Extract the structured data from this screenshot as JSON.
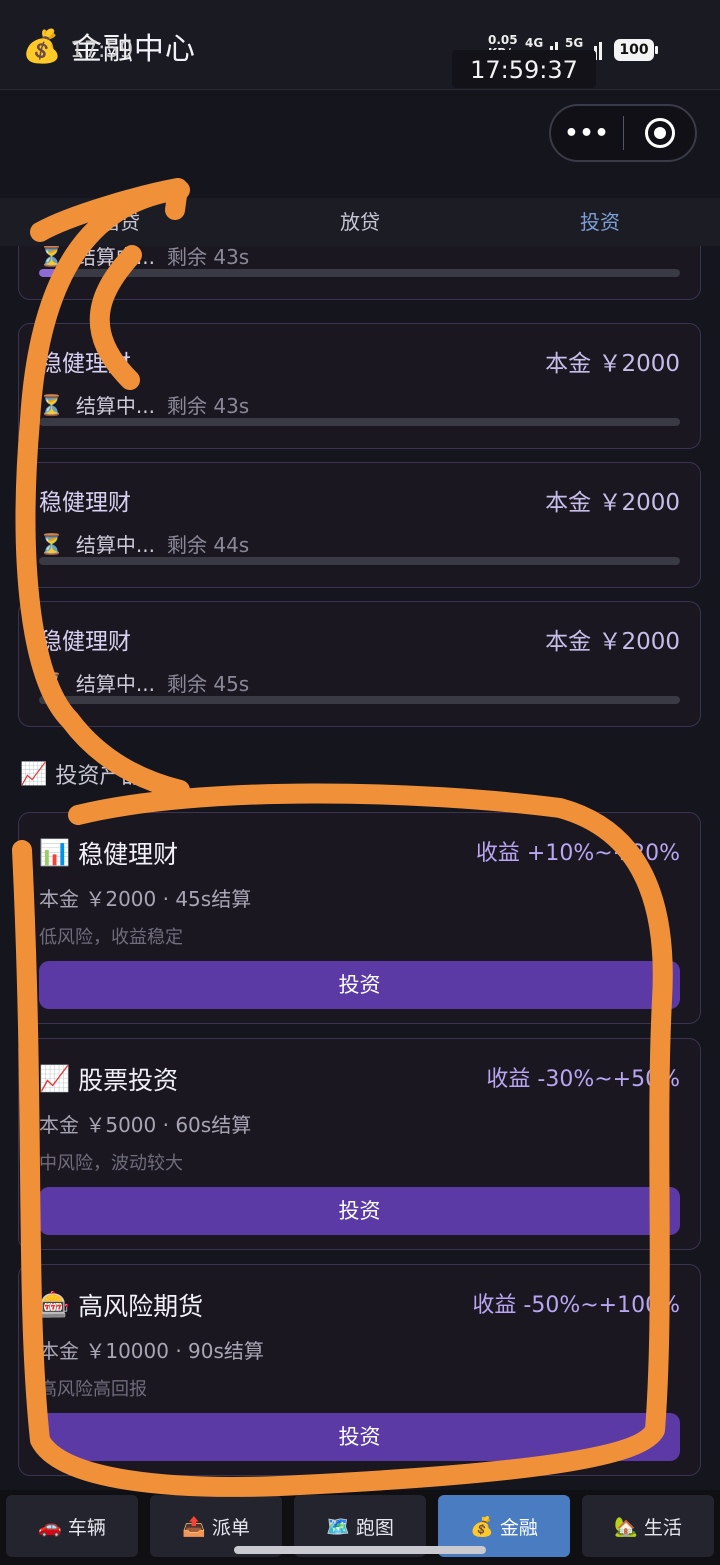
{
  "status_bar": {
    "time_small": "17:59",
    "network_speed": "0.05 KB/s",
    "network_type": "4G",
    "network_type2": "5G",
    "battery": "100",
    "clock": "17:59:37"
  },
  "header": {
    "icon": "💰",
    "title": "金融中心",
    "capsule_more": "•••"
  },
  "tabs": [
    {
      "label": "借贷",
      "active": false
    },
    {
      "label": "放贷",
      "active": false
    },
    {
      "label": "投资",
      "active": true
    }
  ],
  "tasks": [
    {
      "name": "",
      "principal": "",
      "status_icon": "⏳",
      "status": "结算中...",
      "remain": "剩余 43s",
      "progress": 0.05
    },
    {
      "name": "稳健理财",
      "principal": "本金 ￥2000",
      "status_icon": "⏳",
      "status": "结算中...",
      "remain": "剩余 43s",
      "progress": 0.0
    },
    {
      "name": "稳健理财",
      "principal": "本金 ￥2000",
      "status_icon": "⏳",
      "status": "结算中...",
      "remain": "剩余 44s",
      "progress": 0.0
    },
    {
      "name": "稳健理财",
      "principal": "本金 ￥2000",
      "status_icon": "⏳",
      "status": "结算中...",
      "remain": "剩余 45s",
      "progress": 0.0
    }
  ],
  "section": {
    "icon": "📈",
    "title": "投资产品"
  },
  "products": [
    {
      "icon": "📊",
      "name": "稳健理财",
      "yield": "收益 +10%~+20%",
      "info": "本金 ￥2000 · 45s结算",
      "desc": "低风险，收益稳定",
      "button": "投资"
    },
    {
      "icon": "📈",
      "name": "股票投资",
      "yield": "收益 -30%~+50%",
      "info": "本金 ￥5000 · 60s结算",
      "desc": "中风险，波动较大",
      "button": "投资"
    },
    {
      "icon": "🎰",
      "name": "高风险期货",
      "yield": "收益 -50%~+100%",
      "info": "本金 ￥10000 · 90s结算",
      "desc": "高风险高回报",
      "button": "投资"
    }
  ],
  "bottom_nav": [
    {
      "icon": "🚗",
      "label": "车辆",
      "active": false
    },
    {
      "icon": "📤",
      "label": "派单",
      "active": false
    },
    {
      "icon": "🗺️",
      "label": "跑图",
      "active": false
    },
    {
      "icon": "💰",
      "label": "金融",
      "active": true
    },
    {
      "icon": "🏡",
      "label": "生活",
      "active": false
    }
  ],
  "colors": {
    "accent_purple": "#5b3aa6",
    "progress_fill": "#8d6ad8",
    "active_tab": "#7b9fd6",
    "nav_active": "#4a7cc1",
    "annotation_orange": "#f0913a"
  }
}
